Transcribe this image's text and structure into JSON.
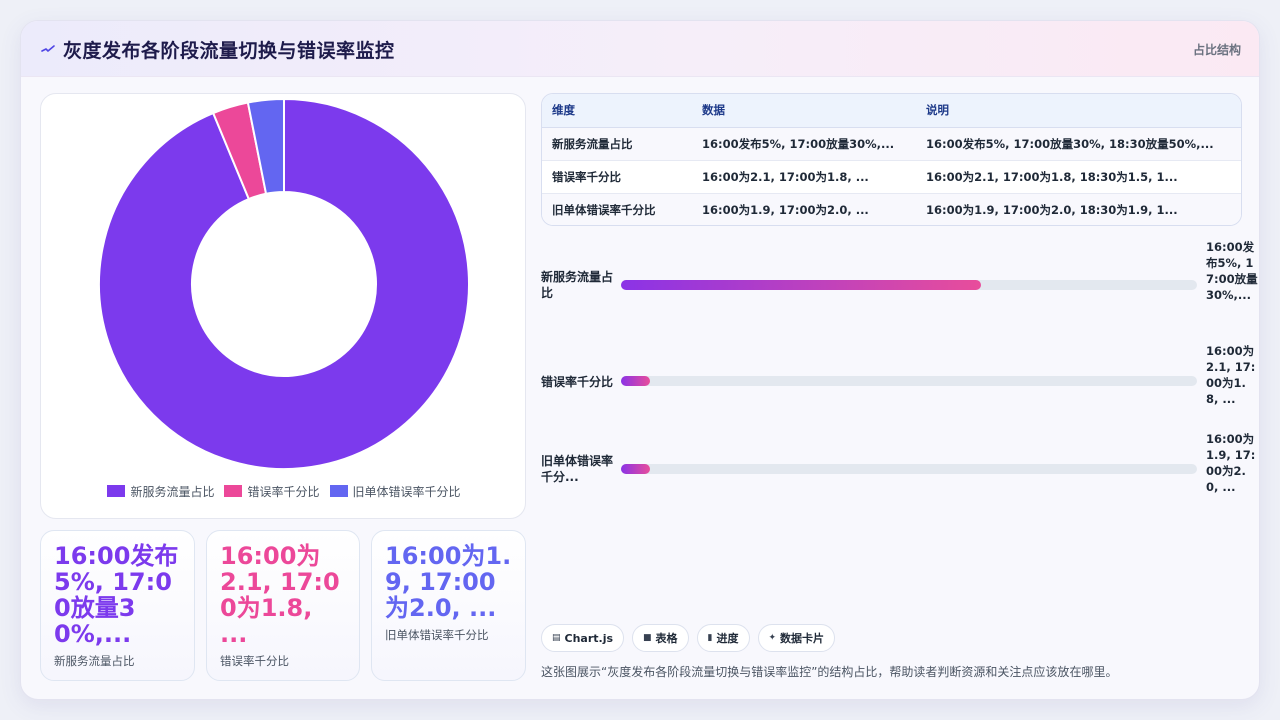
{
  "header": {
    "title": "灰度发布各阶段流量切换与错误率监控",
    "tag": "占比结构"
  },
  "chart_data": {
    "type": "pie",
    "variant": "doughnut",
    "categories": [
      "新服务流量占比",
      "错误率千分比",
      "旧单体错误率千分比"
    ],
    "values": [
      30,
      1.0,
      1.0
    ],
    "colors": [
      "#7c3aed",
      "#ec4899",
      "#6366f1"
    ],
    "legend_position": "bottom"
  },
  "stats": [
    {
      "value": "16:00发布5%, 17:00放量30%,...",
      "label": "新服务流量占比",
      "color": "#7c3aed"
    },
    {
      "value": "16:00为2.1, 17:00为1.8, ...",
      "label": "错误率千分比",
      "color": "#ec4899"
    },
    {
      "value": "16:00为1.9, 17:00为2.0, ...",
      "label": "旧单体错误率千分比",
      "color": "#6366f1"
    }
  ],
  "table": {
    "headers": [
      "维度",
      "数据",
      "说明"
    ],
    "rows": [
      [
        "新服务流量占比",
        "16:00发布5%, 17:00放量30%,...",
        "16:00发布5%, 17:00放量30%, 18:30放量50%,..."
      ],
      [
        "错误率千分比",
        "16:00为2.1, 17:00为1.8, ...",
        "16:00为2.1, 17:00为1.8, 18:30为1.5, 1..."
      ],
      [
        "旧单体错误率千分比",
        "16:00为1.9, 17:00为2.0, ...",
        "16:00为1.9, 17:00为2.0, 18:30为1.9, 1..."
      ]
    ]
  },
  "progress": [
    {
      "label": "新服务流量占比",
      "value": "16:00发布5%, 17:00放量30%,...",
      "fraction": 0.625
    },
    {
      "label": "错误率千分比",
      "value": "16:00为2.1, 17:00为1.8, ...",
      "fraction": 0.05
    },
    {
      "label": "旧单体错误率千分比",
      "display_label": "旧单体错误率千分...",
      "value": "16:00为1.9, 17:00为2.0, ...",
      "fraction": 0.05
    }
  ],
  "chips": [
    {
      "icon": "chart-icon",
      "label": "Chart.js"
    },
    {
      "icon": "table-icon",
      "label": "表格"
    },
    {
      "icon": "folder-icon",
      "label": "进度"
    },
    {
      "icon": "sparkle-icon",
      "label": "数据卡片"
    }
  ],
  "footnote": "这张图展示“灰度发布各阶段流量切换与错误率监控”的结构占比，帮助读者判断资源和关注点应该放在哪里。"
}
